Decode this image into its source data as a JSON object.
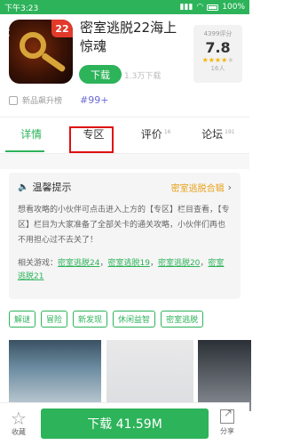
{
  "status": {
    "time": "下午3:23",
    "battery": "100%"
  },
  "app": {
    "name": "密室逃脱22海上惊魂",
    "icon_badge": "22",
    "download_label": "下载",
    "download_count": "1.3万下载",
    "rating_label": "4399评分",
    "rating": "7.8",
    "rating_count": "16人"
  },
  "meta": {
    "tag": "新品飙升榜",
    "rank": "#99+"
  },
  "tabs": [
    {
      "label": "详情"
    },
    {
      "label": "专区"
    },
    {
      "label": "评价",
      "count": "16"
    },
    {
      "label": "论坛",
      "count": "191"
    }
  ],
  "tips": {
    "title": "温馨提示",
    "link": "密室逃脱合辑",
    "body": "想看攻略的小伙伴可点击进入上方的【专区】栏目查看，【专区】栏目为大家准备了全部关卡的通关攻略，小伙伴们再也不用担心过不去关了！",
    "related_label": "相关游戏：",
    "related": [
      "密室逃脱24",
      "密室逃脱19",
      "密室逃脱20",
      "密室逃脱21"
    ]
  },
  "tags": [
    "解谜",
    "冒险",
    "新发现",
    "休闲益智",
    "密室逃脱"
  ],
  "bottom": {
    "favorite_label": "收藏",
    "download_label": "下载 41.59M",
    "share_label": "分享"
  },
  "colors": {
    "accent": "#2db35a",
    "highlight": "#e01010",
    "link_orange": "#e8a21a",
    "rank_purple": "#6b6bd8"
  }
}
